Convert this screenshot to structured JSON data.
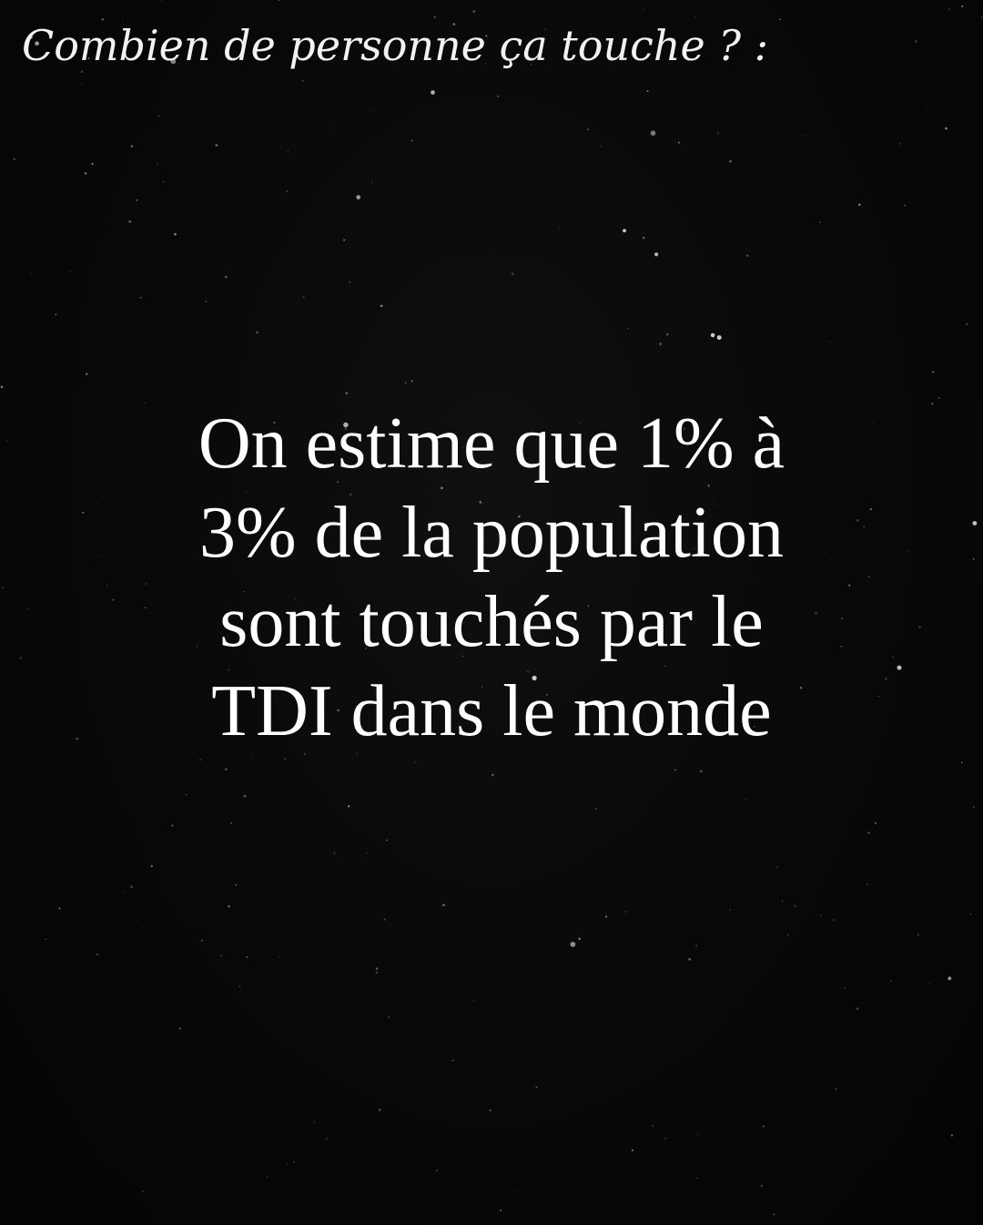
{
  "heading": "Combien de personne ça touche ? :",
  "statement_lines": [
    "On estime que 1% à",
    "3% de la population",
    "sont touchés par le",
    "TDI dans le monde"
  ],
  "colors": {
    "background": "#070707",
    "text": "#ffffff",
    "stars": "#d8d8d8"
  }
}
